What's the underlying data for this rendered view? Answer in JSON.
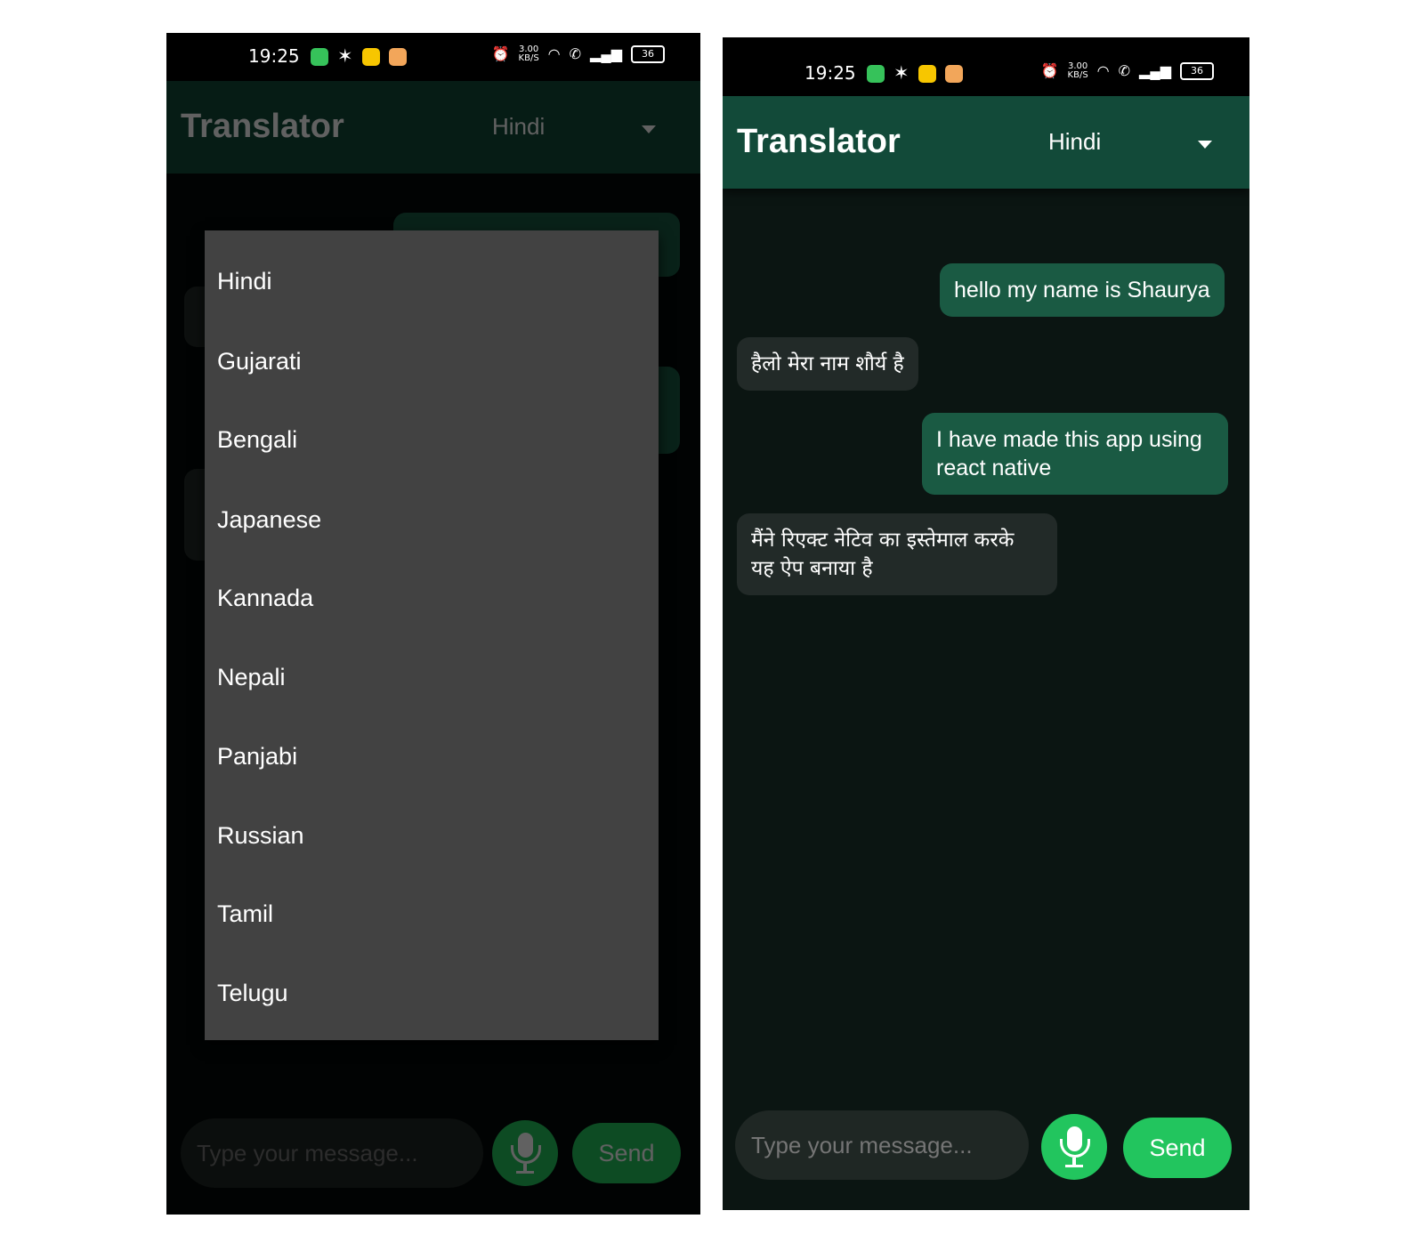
{
  "status_bar": {
    "time": "19:25",
    "speed": "3.00",
    "speed_unit": "KB/S",
    "battery": "36"
  },
  "app": {
    "title": "Translator",
    "selected_language": "Hindi"
  },
  "language_options": [
    "Hindi",
    "Gujarati",
    "Bengali",
    "Japanese",
    "Kannada",
    "Nepali",
    "Panjabi",
    "Russian",
    "Tamil",
    "Telugu"
  ],
  "messages": [
    {
      "from": "user",
      "text": "hello my name is Shaurya"
    },
    {
      "from": "bot",
      "text": "हैलो मेरा नाम शौर्य है"
    },
    {
      "from": "user",
      "text": "I have made this app using react native"
    },
    {
      "from": "bot",
      "text": "मैंने रिएक्ट नेटिव का इस्तेमाल करके यह ऐप बनाया है"
    }
  ],
  "composer": {
    "placeholder": "Type your message...",
    "send_label": "Send"
  },
  "colors": {
    "appbar": "#124a39",
    "user_bubble": "#1a5a43",
    "bot_bubble": "#222a28",
    "accent": "#22c55e",
    "dropdown": "#424242",
    "background": "#0b1512"
  },
  "icons": {
    "mic": "microphone-icon",
    "dropdown": "chevron-down-icon"
  }
}
